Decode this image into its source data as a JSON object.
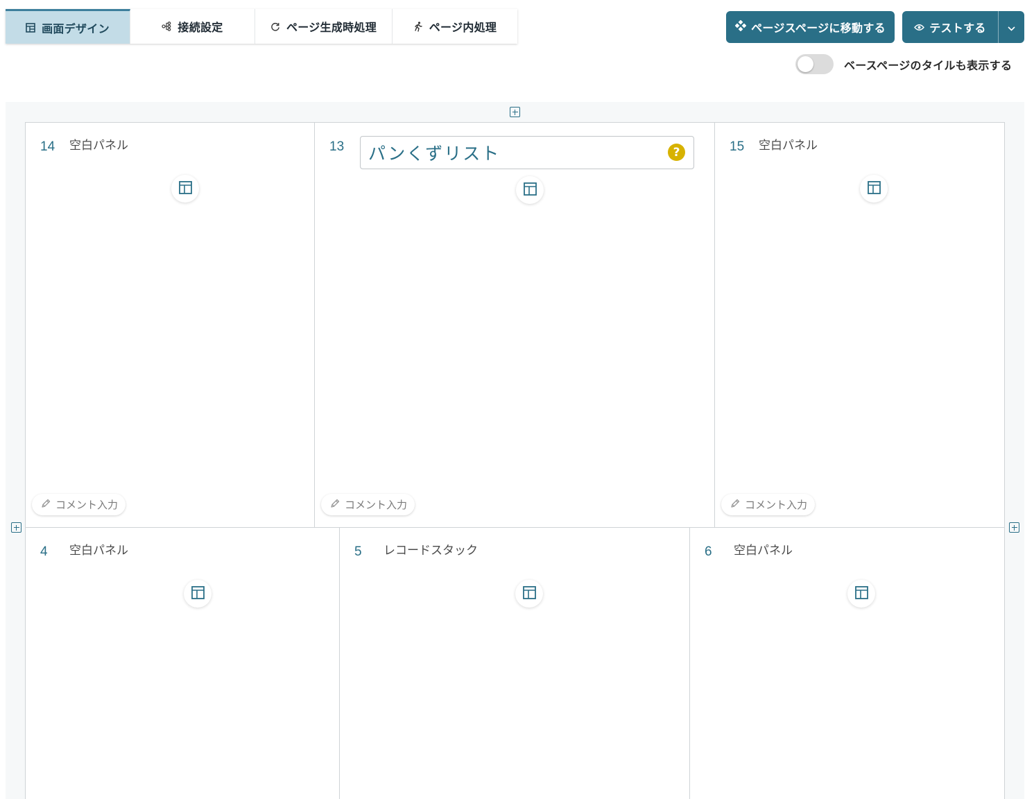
{
  "tabs": [
    {
      "label": "画面デザイン",
      "icon": "layout-icon",
      "active": true
    },
    {
      "label": "接続設定",
      "icon": "connection-icon",
      "active": false
    },
    {
      "label": "ページ生成時処理",
      "icon": "refresh-icon",
      "active": false
    },
    {
      "label": "ページ内処理",
      "icon": "running-icon",
      "active": false
    }
  ],
  "buttons": {
    "base_page": "ページスページに移動する",
    "test": "テストする"
  },
  "toggle": {
    "label": "ベースページのタイルも表示する",
    "checked": false
  },
  "panels": [
    {
      "number": "14",
      "title": "空白パネル",
      "comment": "コメント入力"
    },
    {
      "number": "13",
      "title": "パンくずリスト",
      "comment": "コメント入力",
      "editable": true
    },
    {
      "number": "15",
      "title": "空白パネル",
      "comment": "コメント入力"
    },
    {
      "number": "4",
      "title": "空白パネル"
    },
    {
      "number": "5",
      "title": "レコードスタック"
    },
    {
      "number": "6",
      "title": "空白パネル"
    }
  ],
  "help_symbol": "?",
  "colors": {
    "accent": "#2a6f87",
    "active_tab_bg": "#c3dce7",
    "help": "#d7b200"
  }
}
